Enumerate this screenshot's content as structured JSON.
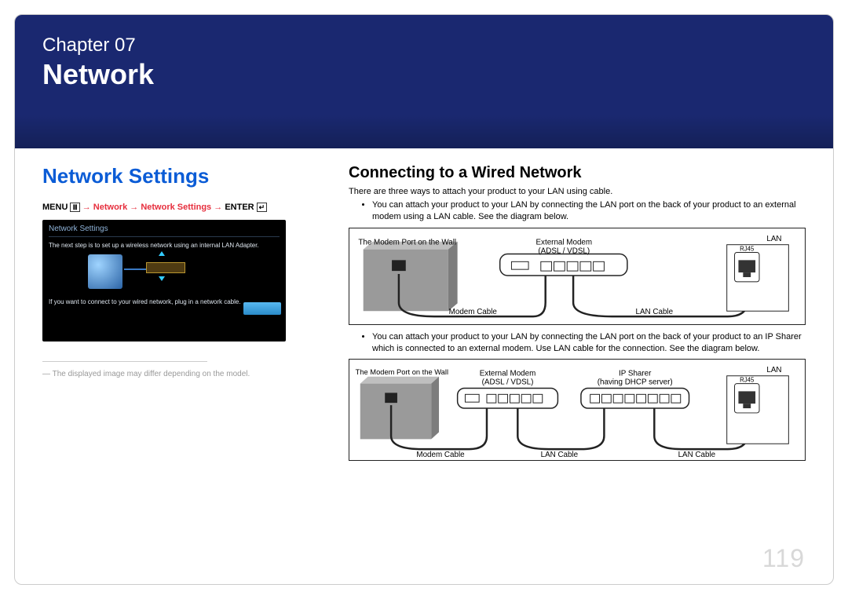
{
  "chapter": {
    "label": "Chapter  07",
    "title": "Network"
  },
  "left": {
    "section_title": "Network Settings",
    "menu_path": {
      "menu": "MENU",
      "crumb1": "Network",
      "crumb2": "Network Settings",
      "enter": "ENTER"
    },
    "tv": {
      "title": "Network Settings",
      "msg1": "The next step is to set up a wireless network using an internal LAN Adapter.",
      "msg2": "If you want to connect to your wired network, plug in a network cable."
    },
    "footnote": "The displayed image may differ depending on the model."
  },
  "right": {
    "sub_title": "Connecting to a Wired Network",
    "intro": "There are three ways to attach your product to your LAN using cable.",
    "bullet1": "You can attach your product to your LAN by connecting the LAN port on the back of your product to an external modem using a LAN cable. See the diagram below.",
    "bullet2": "You can attach your product to your LAN by connecting the LAN port on the back of your product to an IP Sharer which is connected to an external modem. Use LAN cable for the connection. See the diagram below.",
    "diagram1": {
      "wall_label": "The Modem Port on the Wall",
      "modem_label": "External Modem",
      "modem_sub": "(ADSL / VDSL)",
      "lan_top": "LAN",
      "rj45": "RJ45",
      "cable1": "Modem Cable",
      "cable2": "LAN Cable"
    },
    "diagram2": {
      "wall_label": "The Modem Port on the Wall",
      "modem_label": "External Modem",
      "modem_sub": "(ADSL / VDSL)",
      "sharer_label": "IP Sharer",
      "sharer_sub": "(having DHCP server)",
      "lan_top": "LAN",
      "rj45": "RJ45",
      "cable1": "Modem Cable",
      "cable2": "LAN Cable",
      "cable3": "LAN Cable"
    }
  },
  "page_number": "119"
}
